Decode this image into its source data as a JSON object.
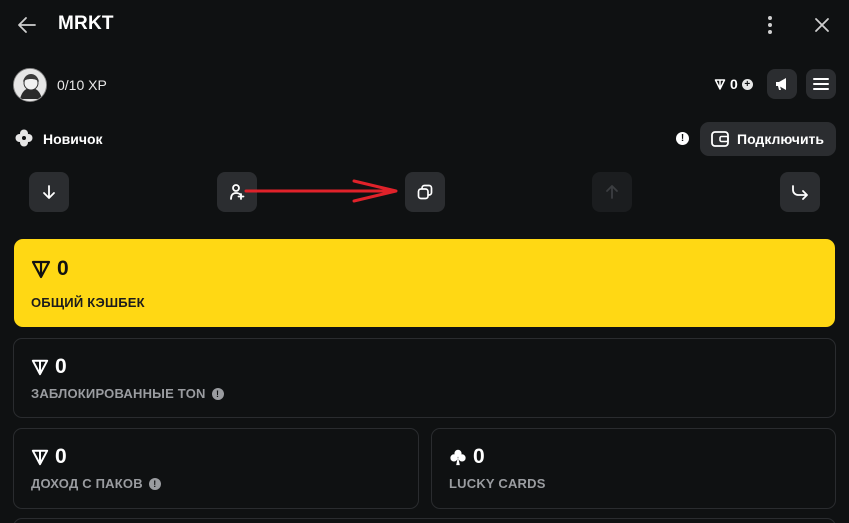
{
  "window": {
    "title": "MRKT"
  },
  "profile": {
    "xp": "0/10 XP",
    "balance": "0"
  },
  "rank": {
    "label": "Новичок",
    "connect_label": "Подключить"
  },
  "actions": [
    {
      "icon": "arrow-down-icon"
    },
    {
      "icon": "invite-user-icon"
    },
    {
      "icon": "copy-icon"
    },
    {
      "icon": "arrow-up-icon",
      "disabled": true
    },
    {
      "icon": "share-forward-icon"
    }
  ],
  "cards": {
    "total_cashback": {
      "value": "0",
      "label": "ОБЩИЙ КЭШБЕК"
    },
    "locked_ton": {
      "value": "0",
      "label": "ЗАБЛОКИРОВАННЫЕ TON"
    },
    "pack_income": {
      "value": "0",
      "label": "ДОХОД С ПАКОВ"
    },
    "lucky_cards": {
      "value": "0",
      "label": "LUCKY CARDS"
    }
  },
  "colors": {
    "background": "#0f1112",
    "accent_yellow": "#ffd814",
    "button": "#2b2d30",
    "annotation_arrow": "#e0222a"
  }
}
